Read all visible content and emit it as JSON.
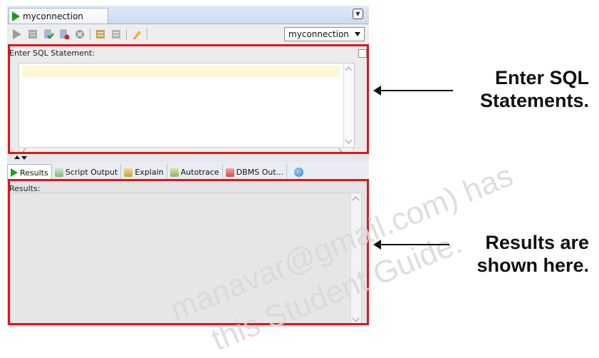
{
  "window": {
    "tab_title": "myconnection",
    "connection_select": "myconnection"
  },
  "toolbar": {
    "icons": [
      "run-statement-icon",
      "run-script-icon",
      "commit-icon",
      "rollback-icon",
      "cancel-icon",
      "sql-history-icon",
      "explain-icon",
      "clear-icon"
    ]
  },
  "sql_editor": {
    "label": "Enter SQL Statement:",
    "content": ""
  },
  "results_tabs": [
    {
      "label": "Results",
      "icon": "run-icon",
      "active": true
    },
    {
      "label": "Script Output",
      "icon": "script-icon",
      "active": false
    },
    {
      "label": "Explain",
      "icon": "explain-icon",
      "active": false
    },
    {
      "label": "Autotrace",
      "icon": "autotrace-icon",
      "active": false
    },
    {
      "label": "DBMS Out...",
      "icon": "dbms-icon",
      "active": false
    },
    {
      "label": "",
      "icon": "globe-icon",
      "active": false
    }
  ],
  "results": {
    "label": "Results:"
  },
  "callouts": {
    "sql_line1": "Enter SQL",
    "sql_line2": "Statements.",
    "results_line1": "Results are",
    "results_line2": "shown here."
  },
  "watermark": {
    "line1": "manavar@gmail.com) has",
    "line2": "this Student Guide."
  },
  "colors": {
    "highlight": "#e3141c",
    "run_green": "#1a9e1a"
  }
}
